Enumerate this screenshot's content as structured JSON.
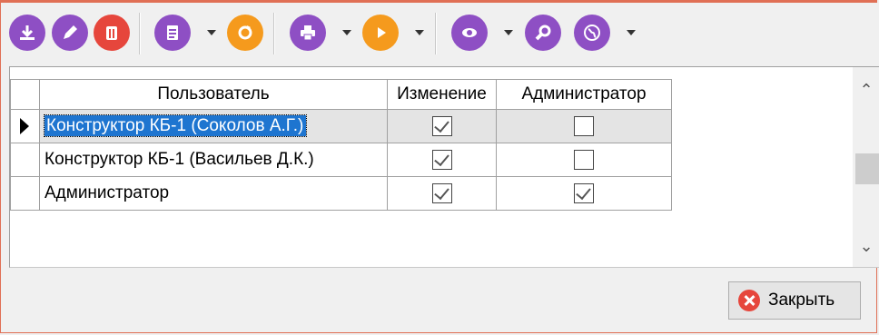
{
  "toolbar": {
    "buttons": [
      {
        "icon": "download-icon"
      },
      {
        "icon": "edit-pencil-icon"
      },
      {
        "icon": "delete-trash-icon"
      },
      {
        "icon": "document-icon"
      },
      {
        "icon": "refresh-icon"
      },
      {
        "icon": "printer-icon"
      },
      {
        "icon": "play-icon"
      },
      {
        "icon": "eye-icon"
      },
      {
        "icon": "search-magnifier-icon"
      },
      {
        "icon": "globe-icon"
      }
    ]
  },
  "grid": {
    "columns": [
      "Пользователь",
      "Изменение",
      "Администратор"
    ],
    "rows": [
      {
        "user": "Конструктор КБ-1 (Соколов А.Г.)",
        "change": true,
        "admin": false,
        "selected": true
      },
      {
        "user": "Конструктор КБ-1 (Васильев Д.К.)",
        "change": true,
        "admin": false,
        "selected": false
      },
      {
        "user": "Администратор",
        "change": true,
        "admin": true,
        "selected": false
      }
    ]
  },
  "footer": {
    "close_label": "Закрыть"
  },
  "colors": {
    "accent_purple": "#8e4fc4",
    "accent_red": "#e6463c",
    "accent_orange": "#f59a1d",
    "selection": "#1e75d0",
    "window_border": "#e06f55"
  }
}
